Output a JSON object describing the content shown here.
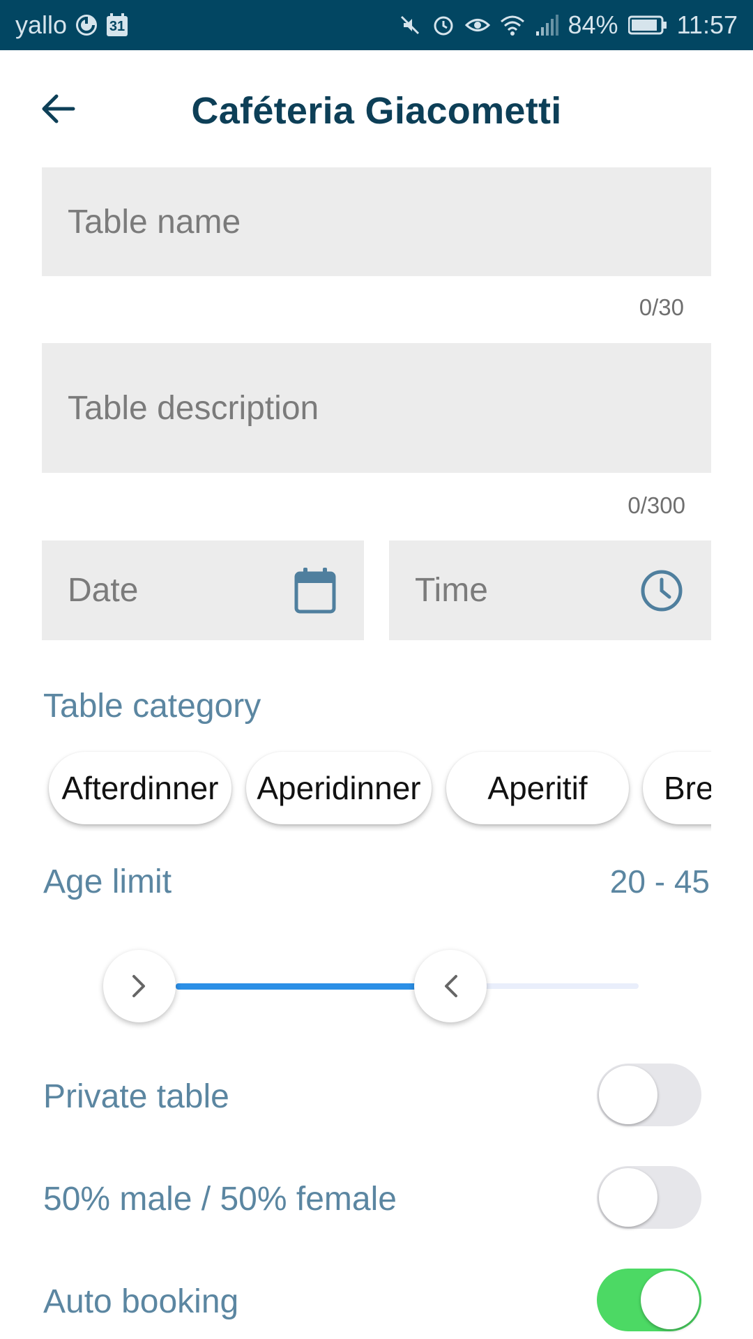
{
  "status_bar": {
    "carrier": "yallo",
    "calendar_day": "31",
    "battery": "84%",
    "time": "11:57",
    "icons": [
      "sync-icon",
      "calendar-icon",
      "mute-icon",
      "alarm-icon",
      "eye-icon",
      "wifi-icon",
      "signal-icon",
      "battery-icon"
    ]
  },
  "header": {
    "title": "Caféteria Giacometti",
    "back_icon": "arrow-left-icon"
  },
  "form": {
    "table_name": {
      "placeholder": "Table name",
      "counter": "0/30"
    },
    "table_description": {
      "placeholder": "Table description",
      "counter": "0/300"
    },
    "date": {
      "placeholder": "Date",
      "icon": "calendar-icon"
    },
    "time": {
      "placeholder": "Time",
      "icon": "clock-icon"
    }
  },
  "category": {
    "label": "Table category",
    "chips": [
      "Afterdinner",
      "Aperidinner",
      "Aperitif",
      "Bre"
    ]
  },
  "age_limit": {
    "label": "Age limit",
    "value": "20 - 45",
    "min": 20,
    "max": 45
  },
  "toggles": [
    {
      "label": "Private table",
      "on": false
    },
    {
      "label": "50% male / 50% female",
      "on": false
    },
    {
      "label": "Auto booking",
      "on": true
    }
  ],
  "colors": {
    "status_bar": "#024662",
    "title": "#0d3f57",
    "label": "#5b86a1",
    "field_bg": "#ececec",
    "slider_fill": "#2b8fe6",
    "toggle_on": "#4cd964"
  }
}
